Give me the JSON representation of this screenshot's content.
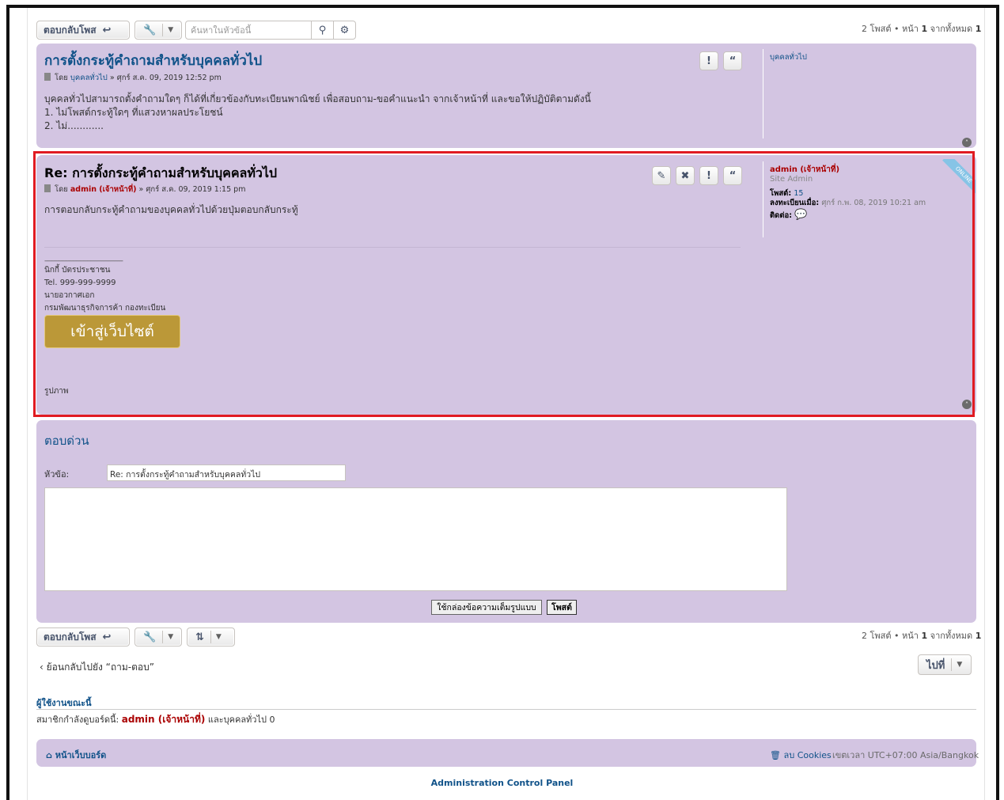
{
  "toolbar_top": {
    "reply_label": "ตอบกลับโพส",
    "search_placeholder": "ค้นหาในหัวข้อนี้",
    "pagination": {
      "count": "2 โพสต์",
      "bullet": "•",
      "page_prefix": "หน้า",
      "page": "1",
      "of": "จากทั้งหมด",
      "total": "1"
    }
  },
  "post1": {
    "title": "การตั้งกระทู้คำถามสำหรับบุคคลทั่วไป",
    "meta_by": "โดย",
    "author": "บุคคลทั่วไป",
    "date": "» ศุกร์ ส.ค. 09, 2019 12:52 pm",
    "content": [
      "บุคคลทั่วไปสามารถตั้งคำถามใดๆ ก็ได้ที่เกี่ยวข้องกับทะเบียนพาณิชย์ เพื่อสอบถาม-ขอคำแนะนำ จากเจ้าหน้าที่ และขอให้ปฏิบัติตามดังนี้",
      "1. ไม่โพสต์กระทู้ใดๆ ที่แสวงหาผลประโยชน์",
      "2. ไม่............"
    ],
    "profile_name": "บุคคลทั่วไป"
  },
  "post2": {
    "title": "Re: การตั้งกระทู้คำถามสำหรับบุคคลทั่วไป",
    "meta_by": "โดย",
    "author": "admin (เจ้าหน้าที่)",
    "date": "» ศุกร์ ส.ค. 09, 2019 1:15 pm",
    "content": "การตอบกลับกระทู้คำถามของบุคคลทั่วไปด้วยปุ่มตอบกลับกระทู้",
    "signature": {
      "rule": "--------------------------------------------",
      "lines": [
        "นิกกี้ บัตรประชาชน",
        "Tel. 999-999-9999",
        "นายอวกาศเอก",
        "กรมพัฒนาธุรกิจการค้า กองทะเบียน"
      ],
      "button": "เข้าสู่เว็บไซต์",
      "image_label": "รูปภาพ"
    },
    "profile": {
      "name": "admin (เจ้าหน้าที่)",
      "rank": "Site Admin",
      "posts_label": "โพสต์:",
      "posts": "15",
      "joined_label": "ลงทะเบียนเมื่อ:",
      "joined": "ศุกร์ ก.พ. 08, 2019 10:21 am",
      "contact_label": "ติดต่อ:"
    },
    "online_badge": "ONLINE"
  },
  "quick_reply": {
    "title": "ตอบด่วน",
    "subject_label": "หัวข้อ:",
    "subject_value": "Re: การตั้งกระทู้คำถามสำหรับบุคคลทั่วไป",
    "full_editor_button": "ใช้กล่องข้อความเต็มรูปแบบ",
    "post_button": "โพสต์"
  },
  "toolbar_bottom": {
    "reply_label": "ตอบกลับโพส",
    "pagination": {
      "count": "2 โพสต์",
      "bullet": "•",
      "page_prefix": "หน้า",
      "page": "1",
      "of": "จากทั้งหมด",
      "total": "1"
    }
  },
  "back_link": "ย้อนกลับไปยัง “ถาม-ตอบ”",
  "jump_label": "ไปที่",
  "whois": {
    "title": "ผู้ใช้งานขณะนี้",
    "prefix": "สมาชิกกำลังดูบอร์ดนี้:",
    "admin": "admin (เจ้าหน้าที่)",
    "suffix": "และบุคคลทั่วไป 0"
  },
  "footer": {
    "board_index": "หน้าเว็บบอร์ด",
    "delete_cookies": "ลบ Cookies",
    "timezone": "เขตเวลา UTC+07:00 Asia/Bangkok",
    "acp": "Administration Control Panel"
  },
  "colors": {
    "panel": "#d3c5e2",
    "link": "#105289",
    "admin_red": "#aa0000",
    "highlight": "#e01b22",
    "gold_button": "#bb9838"
  }
}
